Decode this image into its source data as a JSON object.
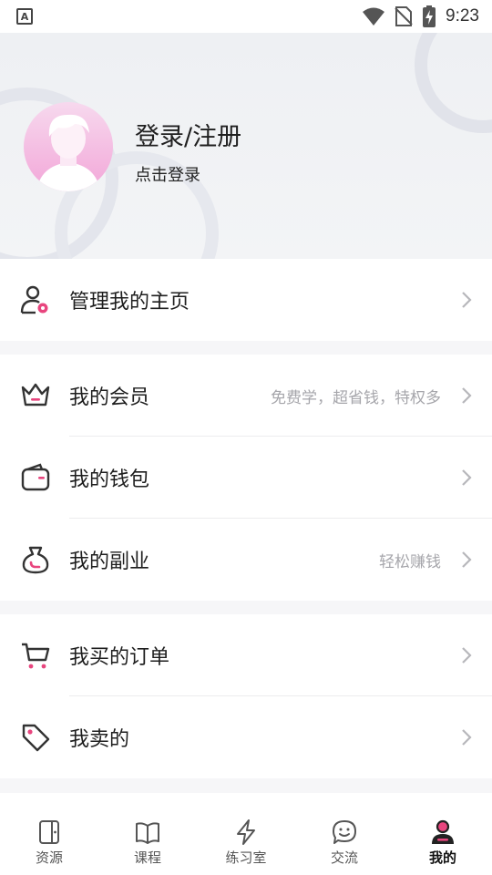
{
  "status_bar": {
    "time": "9:23"
  },
  "profile": {
    "title": "登录/注册",
    "subtitle": "点击登录"
  },
  "menu": {
    "manage": {
      "label": "管理我的主页"
    },
    "member": {
      "label": "我的会员",
      "hint": "免费学，超省钱，特权多"
    },
    "wallet": {
      "label": "我的钱包"
    },
    "side": {
      "label": "我的副业",
      "hint": "轻松赚钱"
    },
    "orders": {
      "label": "我买的订单"
    },
    "sold": {
      "label": "我卖的"
    }
  },
  "tabs": [
    {
      "label": "资源",
      "icon": "resource-icon"
    },
    {
      "label": "课程",
      "icon": "book-icon"
    },
    {
      "label": "练习室",
      "icon": "lightning-icon"
    },
    {
      "label": "交流",
      "icon": "chat-icon"
    },
    {
      "label": "我的",
      "icon": "profile-icon",
      "active": true
    }
  ],
  "colors": {
    "accent": "#e8457e",
    "icon_dark": "#333333",
    "hint": "#a6a6ab"
  }
}
